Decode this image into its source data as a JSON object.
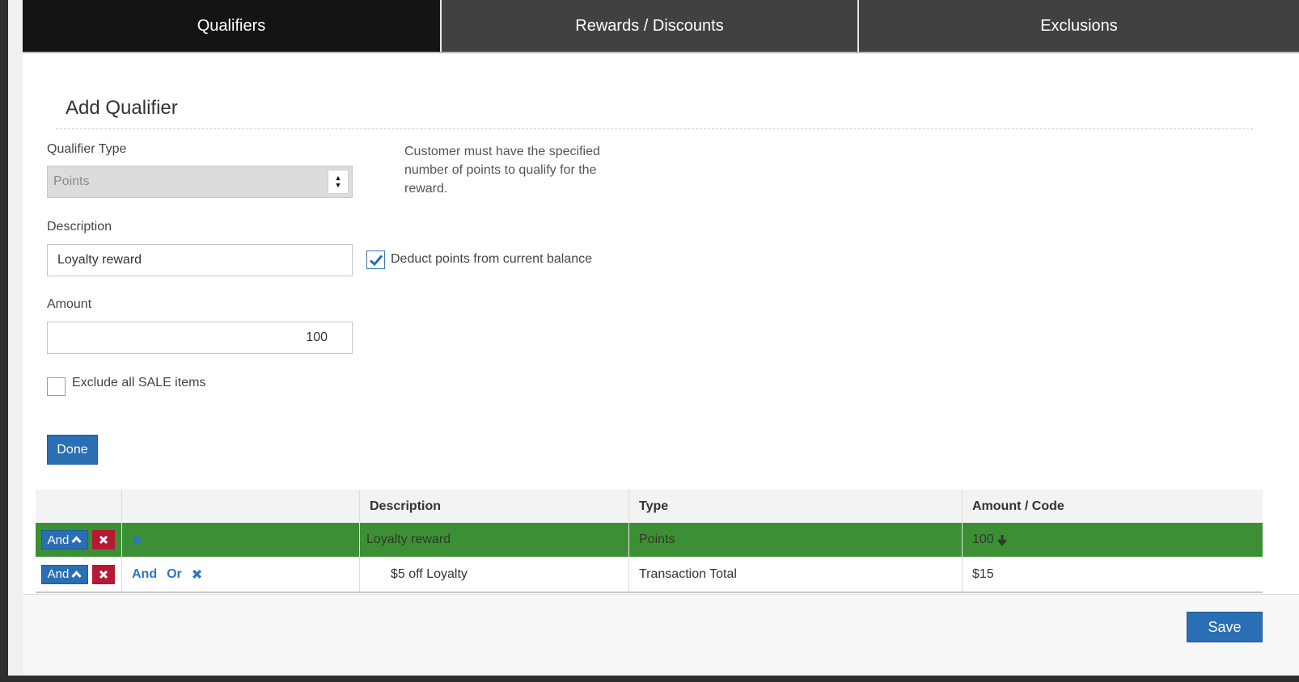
{
  "tabs": [
    {
      "label": "Qualifiers",
      "active": true
    },
    {
      "label": "Rewards / Discounts",
      "active": false
    },
    {
      "label": "Exclusions",
      "active": false
    }
  ],
  "form": {
    "title": "Add Qualifier",
    "qualifier_type_label": "Qualifier Type",
    "qualifier_type_value": "Points",
    "help_text": "Customer must have the specified number of points to qualify for the reward.",
    "description_label": "Description",
    "description_value": "Loyalty reward",
    "deduct_label": "Deduct points from current balance",
    "deduct_checked": true,
    "amount_label": "Amount",
    "amount_value": "100",
    "exclude_sale_label": "Exclude all SALE items",
    "exclude_sale_checked": false,
    "done_label": "Done"
  },
  "table": {
    "headers": [
      "",
      "",
      "Description",
      "Type",
      "Amount / Code"
    ],
    "rows": [
      {
        "logic": "And",
        "description": "Loyalty reward",
        "type": "Points",
        "amount": "100",
        "highlighted": true
      },
      {
        "logic": "And",
        "links": [
          "And",
          "Or"
        ],
        "description": "$5 off Loyalty",
        "type": "Transaction Total",
        "amount": "$15",
        "highlighted": false
      }
    ]
  },
  "footer": {
    "save_label": "Save"
  },
  "colors": {
    "primary": "#2a6eb3",
    "danger": "#b61935",
    "highlight_row": "#3d8f35",
    "tab_active": "#141414",
    "tab_inactive": "#414141"
  }
}
